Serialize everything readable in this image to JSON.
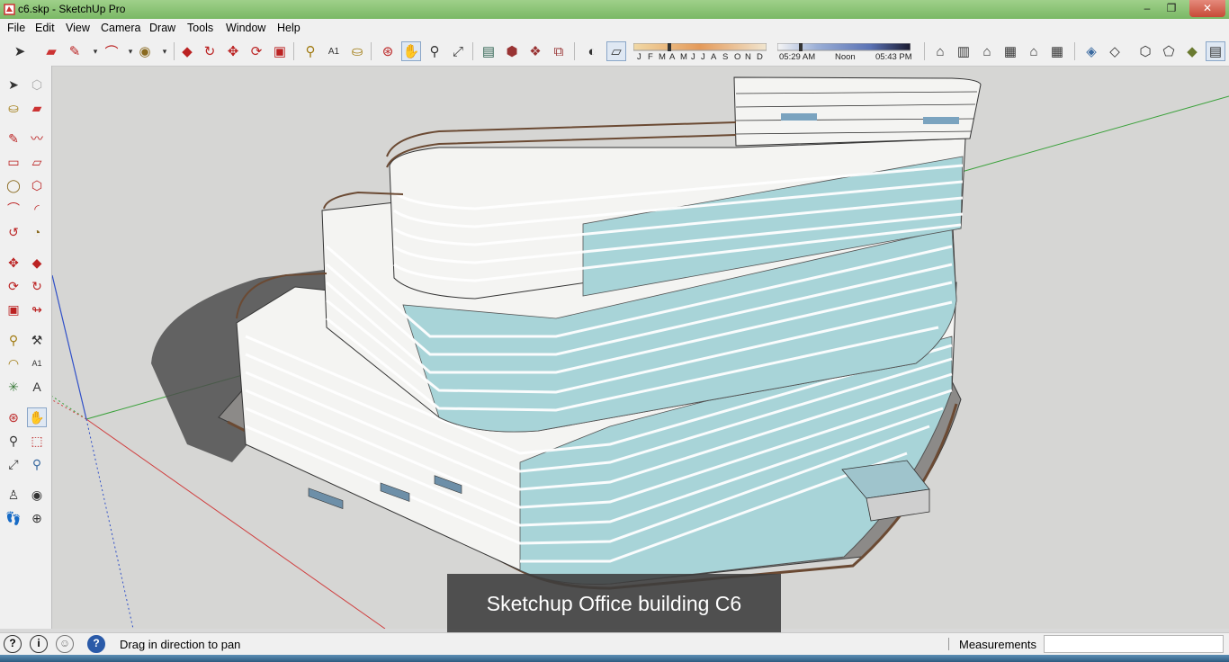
{
  "window": {
    "title": "c6.skp - SketchUp Pro",
    "controls": {
      "minimize": "–",
      "maximize": "❐",
      "close": "✕"
    }
  },
  "menu": [
    "File",
    "Edit",
    "View",
    "Camera",
    "Draw",
    "Tools",
    "Window",
    "Help"
  ],
  "shadows": {
    "months": [
      "J",
      "F",
      "M",
      "A",
      "M",
      "J",
      "J",
      "A",
      "S",
      "O",
      "N",
      "D"
    ],
    "time_start": "05:29 AM",
    "time_mid": "Noon",
    "time_end": "05:43 PM"
  },
  "viewport": {
    "caption": "Sketchup Office building C6"
  },
  "status": {
    "hint": "Drag in direction to pan",
    "measurements_label": "Measurements",
    "measurements_value": ""
  },
  "colors": {
    "axis_red": "#d04040",
    "axis_green": "#3aa13a",
    "axis_blue": "#3050c8",
    "glass": "#a8d4d8",
    "facade": "#f4f4f2",
    "rail": "#6b4a33"
  }
}
